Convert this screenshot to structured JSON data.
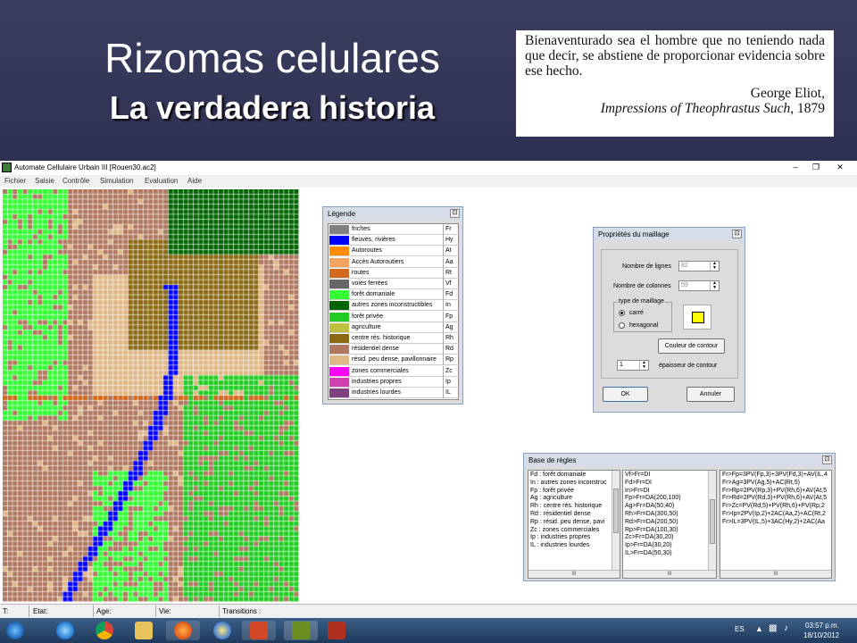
{
  "slide": {
    "title": "Rizomas celulares",
    "subtitle": "La verdadera historia",
    "quote": {
      "text": "Bienaventurado sea el hombre que no teniendo nada que decir, se abstiene de proporcionar evidencia sobre ese hecho.",
      "author": "George Eliot,",
      "work": "Impressions of Theophrastus Such",
      "year": ", 1879"
    }
  },
  "app": {
    "window_title": "Automate Cellulaire Urbain III [Rouen30.ac2]",
    "menu": [
      "Fichier",
      "Saisie",
      "Contrôle",
      "Simulation",
      "Evaluation",
      "Aide"
    ],
    "status": {
      "t": "T:",
      "etat": "Etat:",
      "age": "Age:",
      "vie": "Vie:",
      "transitions": "Transitions :"
    }
  },
  "legend": {
    "title": "Légende",
    "items": [
      {
        "label": "friches",
        "code": "Fr",
        "color": "#808080"
      },
      {
        "label": "fleuves, rivières",
        "code": "Hy",
        "color": "#0000ff"
      },
      {
        "label": "Autoroutes",
        "code": "At",
        "color": "#ff8c00"
      },
      {
        "label": "Accès Autoroutiers",
        "code": "Aa",
        "color": "#f4a460"
      },
      {
        "label": "routes",
        "code": "Rt",
        "color": "#d2691e"
      },
      {
        "label": "voies ferrées",
        "code": "Vf",
        "color": "#666666"
      },
      {
        "label": "forêt domaniale",
        "code": "Fd",
        "color": "#33ff33"
      },
      {
        "label": "autres zones inconstructibles",
        "code": "In",
        "color": "#006400"
      },
      {
        "label": "forêt privée",
        "code": "Fp",
        "color": "#22cc22"
      },
      {
        "label": "agriculture",
        "code": "Ag",
        "color": "#c0c040"
      },
      {
        "label": "centre rés. historique",
        "code": "Rh",
        "color": "#8b6914"
      },
      {
        "label": "résidentiel dense",
        "code": "Rd",
        "color": "#b07860"
      },
      {
        "label": "résid. peu dense, pavillonnaire",
        "code": "Rp",
        "color": "#deb887"
      },
      {
        "label": "zones commerciales",
        "code": "Zc",
        "color": "#ff00ff"
      },
      {
        "label": "industries propres",
        "code": "Ip",
        "color": "#d040b0"
      },
      {
        "label": "industries lourdes",
        "code": "IL",
        "color": "#804080"
      }
    ]
  },
  "props": {
    "title": "Propriétés du maillage",
    "rows_label": "Nombre de lignes",
    "rows_value": "82",
    "cols_label": "Nombre de colonnes",
    "cols_value": "59",
    "mesh_type_label": "type de maillage",
    "option_square": "carré",
    "option_hex": "hexagonal",
    "contour_button": "Couleur de contour",
    "thickness_value": "1",
    "thickness_label": "épaisseur de contour",
    "ok": "OK",
    "cancel": "Annuler",
    "swatch_color": "#ffff00"
  },
  "rules": {
    "title": "Base de règles",
    "col1": [
      "Fd : forêt domaniale",
      "In : autres zones inconstruc",
      "Fp : forêt privée",
      "Ag : agriculture",
      "Rh : centre rés. historique",
      "Rd : résidentiel dense",
      "Rp : résid. peu dense, pavi",
      "Zc : zones commerciales",
      "Ip : industries propres",
      "IL : industries lourdes"
    ],
    "col2": [
      "Vf>Fr=DI",
      "Fd>Fr=DI",
      "In>Fr=DI",
      "Fp>Fr=DA(200,100)",
      "Ag>Fr=DA(50,40)",
      "Rh>Fr=DA(300,50)",
      "Rd>Fr=DA(200,50)",
      "Rp>Fr=DA(100,30)",
      "Zc>Fr=DA(30,20)",
      "Ip>Fr=DA(30,20)",
      "IL>Fr=DA(50,30)"
    ],
    "col3": [
      "Fr>Fp=3PV(Fp,3)+3PV(Fd,3)+AV(IL,4",
      "Fr>Ag=3PV(Ag,5)+AC(Rt,5)",
      "Fr>Rp=2PV(Rp,3)+PV(Rh,6)+AV(At,5",
      "Fr>Rd=2PV(Rd,3)+PV(Rh,6)+AV(At,5",
      "Fr>Zc=PV(Rd,5)+PV(Rh,6)+PV(Rp,2",
      "Fr>Ip=2PV(Ip,2)+2AC(Aa,2)+AC(Rt,2",
      "Fr>IL=3PV(IL,5)+3AC(Hy,2)+2AC(Aa"
    ],
    "scroll_glyph": "III"
  },
  "taskbar": {
    "lang": "ES",
    "time": "03:57 p.m.",
    "date": "18/10/2012"
  }
}
